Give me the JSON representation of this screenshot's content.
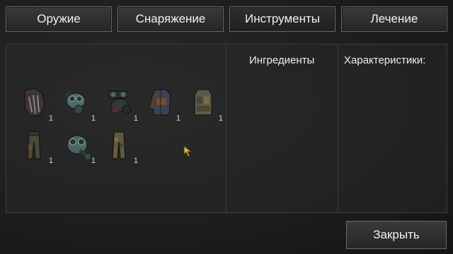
{
  "tabs": [
    {
      "label": "Оружие"
    },
    {
      "label": "Снаряжение"
    },
    {
      "label": "Инструменты"
    },
    {
      "label": "Лечение"
    }
  ],
  "ingredients_title": "Ингредиенты",
  "stats_title": "Характеристики:",
  "items": [
    {
      "icon": "gloves-icon",
      "count": "1"
    },
    {
      "icon": "gas-mask-icon",
      "count": "1"
    },
    {
      "icon": "respirator-icon",
      "count": "1"
    },
    {
      "icon": "jacket-icon",
      "count": "1"
    },
    {
      "icon": "vest-icon",
      "count": "1"
    },
    {
      "icon": "pants-icon",
      "count": "1"
    },
    {
      "icon": "gas-mask-green-icon",
      "count": "1"
    },
    {
      "icon": "camo-pants-icon",
      "count": "1"
    }
  ],
  "close_label": "Закрыть"
}
